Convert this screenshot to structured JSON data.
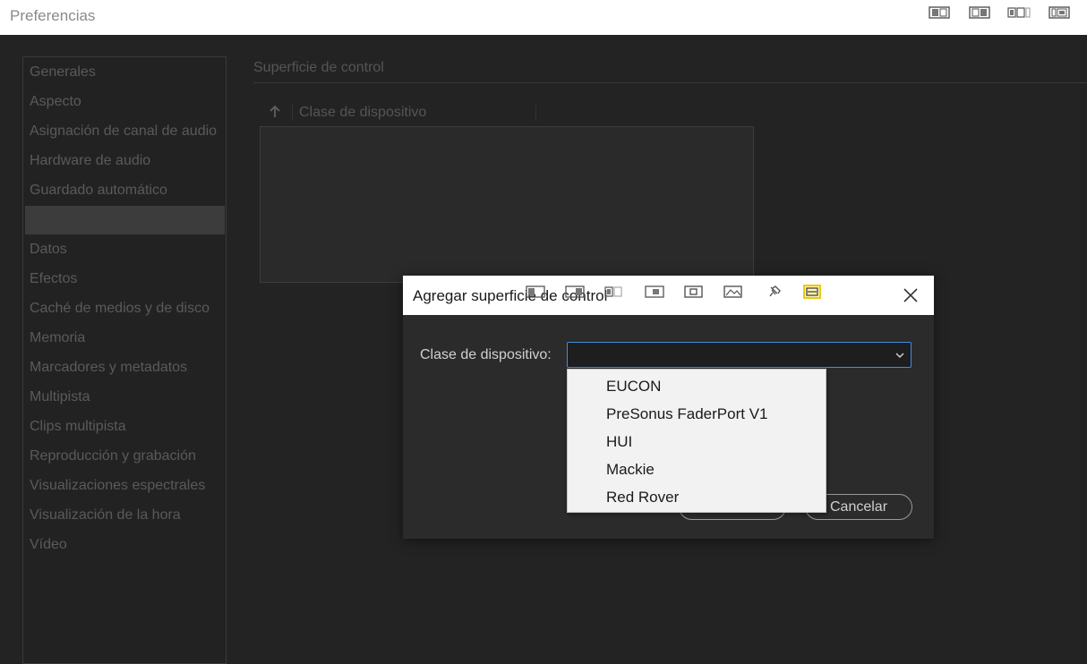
{
  "window": {
    "title": "Preferencias",
    "toolbar_icons": [
      "snap-left-icon",
      "snap-right-icon",
      "snap-split-icon",
      "snap-grid-icon"
    ]
  },
  "sidebar": {
    "items": [
      {
        "label": "Generales"
      },
      {
        "label": "Aspecto"
      },
      {
        "label": "Asignación de canal de audio"
      },
      {
        "label": "Hardware de audio"
      },
      {
        "label": "Guardado automático"
      },
      {
        "label": ""
      },
      {
        "label": "Datos"
      },
      {
        "label": "Efectos"
      },
      {
        "label": "Caché de medios y de disco"
      },
      {
        "label": "Memoria"
      },
      {
        "label": "Marcadores y metadatos"
      },
      {
        "label": "Multipista"
      },
      {
        "label": "Clips multipista"
      },
      {
        "label": "Reproducción y grabación"
      },
      {
        "label": "Visualizaciones espectrales"
      },
      {
        "label": "Visualización de la hora"
      },
      {
        "label": "Vídeo"
      }
    ],
    "selected_index": 5
  },
  "panel": {
    "section_title": "Superficie de control",
    "column_header": "Clase de dispositivo"
  },
  "dialog": {
    "title": "Agregar superficie de control",
    "field_label": "Clase de dispositivo:",
    "select_value": "",
    "ok_label": "",
    "cancel_label": "Cancelar",
    "overlay_icons": [
      "snap-left-icon",
      "snap-right-icon",
      "snap-split-icon",
      "snap-grid-icon",
      "window-capture-icon",
      "image-capture-icon",
      "pin-icon",
      "fullscreen-capture-icon"
    ]
  },
  "dropdown": {
    "options": [
      "EUCON",
      "PreSonus FaderPort V1",
      "HUI",
      "Mackie",
      "Red Rover"
    ]
  },
  "colors": {
    "background": "#232323",
    "sidebar_selected": "#3c3c3c",
    "select_focus": "#3f8fe0",
    "dropdown_bg": "#f2f2f2",
    "highlight_icon": "#e8c400"
  }
}
